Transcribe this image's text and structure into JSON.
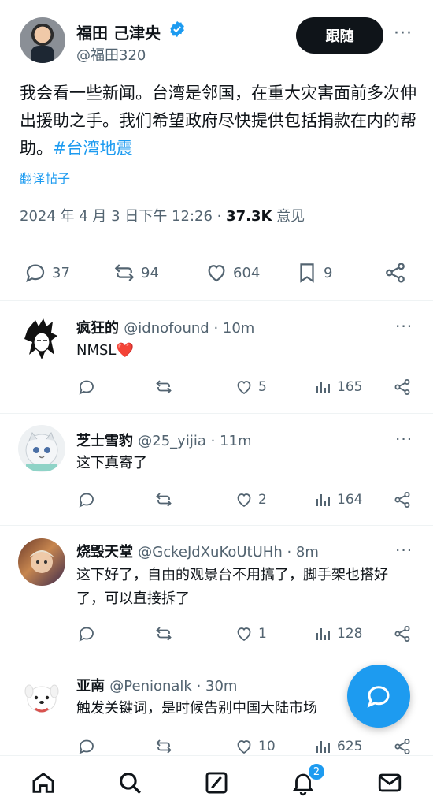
{
  "post": {
    "author_name": "福田 己津央",
    "handle": "@福田320",
    "follow_label": "跟随",
    "more": "···",
    "text": "我会看一些新闻。台湾是邻国，在重大灾害面前多次伸出援助之手。我们希望政府尽快提供包括捐款在内的帮助。",
    "hashtag": "#台湾地震",
    "translate_label": "翻译帖子",
    "timestamp": "2024 年 4 月 3 日下午 12:26 · ",
    "views": "37.3K",
    "views_label": " 意见",
    "counts": {
      "replies": "37",
      "reposts": "94",
      "likes": "604",
      "bookmarks": "9"
    }
  },
  "replies": [
    {
      "name": "疯狂的",
      "handle": "@idnofound",
      "time": " · 10m",
      "text": "NMSL",
      "emoji": "❤️",
      "likes": "5",
      "views": "165"
    },
    {
      "name": "芝士雪豹",
      "handle": "@25_yijia",
      "time": " · 11m",
      "text": "这下真寄了",
      "likes": "2",
      "views": "164"
    },
    {
      "name": "烧毁天堂",
      "handle": "@GckeJdXuKoUtUHh",
      "time": " · 8m",
      "text": "这下好了，自由的观景台不用搞了，脚手架也搭好了，可以直接拆了",
      "likes": "1",
      "views": "128"
    },
    {
      "name": "亚南",
      "handle": "@Penionalk",
      "time": " · 30m",
      "text": "触发关键词，是时候告别中国大陆市场",
      "likes": "10",
      "views": "625"
    }
  ],
  "nav": {
    "notifications_badge": "2"
  },
  "colors": {
    "accent": "#1d9bf0",
    "text": "#0f1419",
    "muted": "#536471",
    "like_red": "#f91880"
  }
}
